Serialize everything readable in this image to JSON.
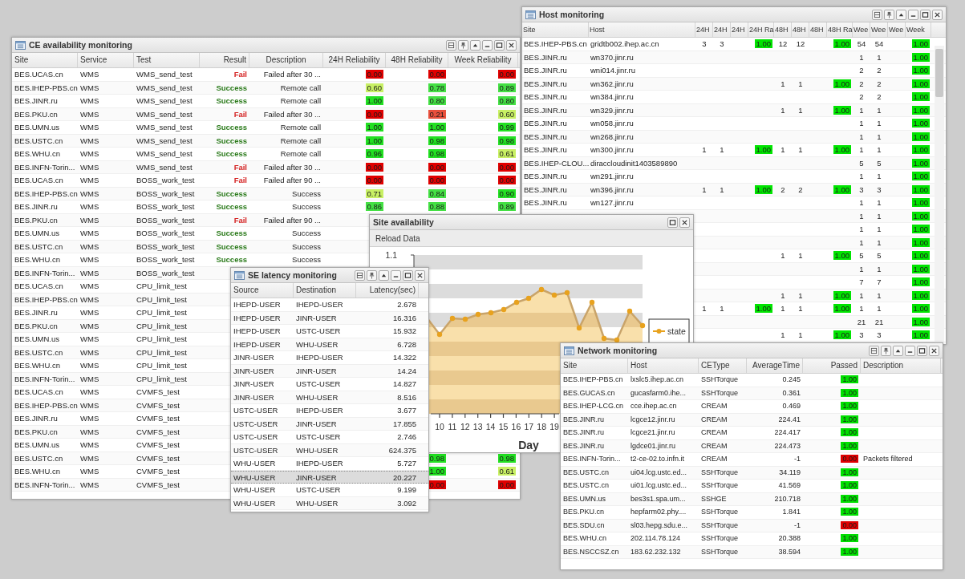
{
  "ce": {
    "title": "CE availability monitoring",
    "columns": [
      "Site",
      "Service",
      "Test",
      "Result",
      "Description",
      "24H Reliability",
      "48H Reliability",
      "Week Reliability"
    ],
    "rows": [
      {
        "site": "BES.UCAS.cn",
        "service": "WMS",
        "test": "WMS_send_test",
        "result": {
          "text": "Fail",
          "color": "#d42020"
        },
        "description": "Failed after 30 ...",
        "r24": {
          "value": "0.00",
          "color": "#e00000"
        },
        "r48": {
          "value": "0.00",
          "color": "#e00000"
        },
        "week": {
          "value": "0.00",
          "color": "#e00000"
        }
      },
      {
        "site": "BES.IHEP-PBS.cn",
        "service": "WMS",
        "test": "WMS_send_test",
        "result": {
          "text": "Success",
          "color": "#2a7a1a"
        },
        "description": "Remote call",
        "r24": {
          "value": "0.60",
          "color": "#c8f064"
        },
        "r48": {
          "value": "0.78",
          "color": "#44e044"
        },
        "week": {
          "value": "0.89",
          "color": "#44e044"
        }
      },
      {
        "site": "BES.JINR.ru",
        "service": "WMS",
        "test": "WMS_send_test",
        "result": {
          "text": "Success",
          "color": "#2a7a1a"
        },
        "description": "Remote call",
        "r24": {
          "value": "1.00",
          "color": "#22e022"
        },
        "r48": {
          "value": "0.80",
          "color": "#44e044"
        },
        "week": {
          "value": "0.80",
          "color": "#44e044"
        }
      },
      {
        "site": "BES.PKU.cn",
        "service": "WMS",
        "test": "WMS_send_test",
        "result": {
          "text": "Fail",
          "color": "#d42020"
        },
        "description": "Failed after 30 ...",
        "r24": {
          "value": "0.00",
          "color": "#e00000"
        },
        "r48": {
          "value": "0.21",
          "color": "#e8503c"
        },
        "week": {
          "value": "0.60",
          "color": "#c8f064"
        }
      },
      {
        "site": "BES.UMN.us",
        "service": "WMS",
        "test": "WMS_send_test",
        "result": {
          "text": "Success",
          "color": "#2a7a1a"
        },
        "description": "Remote call",
        "r24": {
          "value": "1.00",
          "color": "#22e022"
        },
        "r48": {
          "value": "1.00",
          "color": "#22e022"
        },
        "week": {
          "value": "0.99",
          "color": "#22e022"
        }
      },
      {
        "site": "BES.USTC.cn",
        "service": "WMS",
        "test": "WMS_send_test",
        "result": {
          "text": "Success",
          "color": "#2a7a1a"
        },
        "description": "Remote call",
        "r24": {
          "value": "1.00",
          "color": "#22e022"
        },
        "r48": {
          "value": "0.98",
          "color": "#22e022"
        },
        "week": {
          "value": "0.98",
          "color": "#22e022"
        }
      },
      {
        "site": "BES.WHU.cn",
        "service": "WMS",
        "test": "WMS_send_test",
        "result": {
          "text": "Success",
          "color": "#2a7a1a"
        },
        "description": "Remote call",
        "r24": {
          "value": "0.96",
          "color": "#22e022"
        },
        "r48": {
          "value": "0.98",
          "color": "#22e022"
        },
        "week": {
          "value": "0.61",
          "color": "#c8f064"
        }
      },
      {
        "site": "BES.INFN-Torin...",
        "service": "WMS",
        "test": "WMS_send_test",
        "result": {
          "text": "Fail",
          "color": "#d42020"
        },
        "description": "Failed after 30 ...",
        "r24": {
          "value": "0.00",
          "color": "#e00000"
        },
        "r48": {
          "value": "0.00",
          "color": "#e00000"
        },
        "week": {
          "value": "0.00",
          "color": "#e00000"
        }
      },
      {
        "site": "BES.UCAS.cn",
        "service": "WMS",
        "test": "BOSS_work_test",
        "result": {
          "text": "Fail",
          "color": "#d42020"
        },
        "description": "Failed after 90 ...",
        "r24": {
          "value": "0.00",
          "color": "#e00000"
        },
        "r48": {
          "value": "0.00",
          "color": "#e00000"
        },
        "week": {
          "value": "0.00",
          "color": "#e00000"
        }
      },
      {
        "site": "BES.IHEP-PBS.cn",
        "service": "WMS",
        "test": "BOSS_work_test",
        "result": {
          "text": "Success",
          "color": "#2a7a1a"
        },
        "description": "Success",
        "r24": {
          "value": "0.71",
          "color": "#c8f064"
        },
        "r48": {
          "value": "0.84",
          "color": "#44e044"
        },
        "week": {
          "value": "0.90",
          "color": "#22e022"
        }
      },
      {
        "site": "BES.JINR.ru",
        "service": "WMS",
        "test": "BOSS_work_test",
        "result": {
          "text": "Success",
          "color": "#2a7a1a"
        },
        "description": "Success",
        "r24": {
          "value": "0.86",
          "color": "#44e044"
        },
        "r48": {
          "value": "0.88",
          "color": "#44e044"
        },
        "week": {
          "value": "0.89",
          "color": "#44e044"
        }
      },
      {
        "site": "BES.PKU.cn",
        "service": "WMS",
        "test": "BOSS_work_test",
        "result": {
          "text": "Fail",
          "color": "#d42020"
        },
        "description": "Failed after 90 ..."
      },
      {
        "site": "BES.UMN.us",
        "service": "WMS",
        "test": "BOSS_work_test",
        "result": {
          "text": "Success",
          "color": "#2a7a1a"
        },
        "description": "Success"
      },
      {
        "site": "BES.USTC.cn",
        "service": "WMS",
        "test": "BOSS_work_test",
        "result": {
          "text": "Success",
          "color": "#2a7a1a"
        },
        "description": "Success"
      },
      {
        "site": "BES.WHU.cn",
        "service": "WMS",
        "test": "BOSS_work_test",
        "result": {
          "text": "Success",
          "color": "#2a7a1a"
        },
        "description": "Success"
      },
      {
        "site": "BES.INFN-Torin...",
        "service": "WMS",
        "test": "BOSS_work_test"
      },
      {
        "site": "BES.UCAS.cn",
        "service": "WMS",
        "test": "CPU_limit_test"
      },
      {
        "site": "BES.IHEP-PBS.cn",
        "service": "WMS",
        "test": "CPU_limit_test"
      },
      {
        "site": "BES.JINR.ru",
        "service": "WMS",
        "test": "CPU_limit_test"
      },
      {
        "site": "BES.PKU.cn",
        "service": "WMS",
        "test": "CPU_limit_test"
      },
      {
        "site": "BES.UMN.us",
        "service": "WMS",
        "test": "CPU_limit_test"
      },
      {
        "site": "BES.USTC.cn",
        "service": "WMS",
        "test": "CPU_limit_test"
      },
      {
        "site": "BES.WHU.cn",
        "service": "WMS",
        "test": "CPU_limit_test"
      },
      {
        "site": "BES.INFN-Torin...",
        "service": "WMS",
        "test": "CPU_limit_test"
      },
      {
        "site": "BES.UCAS.cn",
        "service": "WMS",
        "test": "CVMFS_test"
      },
      {
        "site": "BES.IHEP-PBS.cn",
        "service": "WMS",
        "test": "CVMFS_test"
      },
      {
        "site": "BES.JINR.ru",
        "service": "WMS",
        "test": "CVMFS_test"
      },
      {
        "site": "BES.PKU.cn",
        "service": "WMS",
        "test": "CVMFS_test"
      },
      {
        "site": "BES.UMN.us",
        "service": "WMS",
        "test": "CVMFS_test"
      },
      {
        "site": "BES.USTC.cn",
        "service": "WMS",
        "test": "CVMFS_test",
        "r48": {
          "value": "0.98",
          "color": "#22e022"
        },
        "week": {
          "value": "0.98",
          "color": "#22e022"
        }
      },
      {
        "site": "BES.WHU.cn",
        "service": "WMS",
        "test": "CVMFS_test",
        "r48": {
          "value": "1.00",
          "color": "#22e022"
        },
        "week": {
          "value": "0.61",
          "color": "#c8f064"
        }
      },
      {
        "site": "BES.INFN-Torin...",
        "service": "WMS",
        "test": "CVMFS_test",
        "r48": {
          "value": "0.00",
          "color": "#e00000"
        },
        "week": {
          "value": "0.00",
          "color": "#e00000"
        }
      }
    ]
  },
  "host": {
    "title": "Host monitoring",
    "columns": [
      "Site",
      "Host",
      "24H",
      "24H",
      "24H",
      "24H Ra",
      "48H",
      "48H",
      "48H",
      "48H Ra",
      "Wee",
      "Wee",
      "Wee",
      "Week"
    ],
    "rows": [
      {
        "site": "BES.IHEP-PBS.cn",
        "host": "gridtb002.ihep.ac.cn",
        "a24": "3",
        "b24": "3",
        "r24": "1.00",
        "a48": "12",
        "b48": "12",
        "r48": "1.00",
        "aw": "54",
        "bw": "54",
        "rw": "1.00"
      },
      {
        "site": "BES.JINR.ru",
        "host": "wn370.jinr.ru",
        "aw": "1",
        "bw": "1",
        "rw": "1.00"
      },
      {
        "site": "BES.JINR.ru",
        "host": "wni014.jinr.ru",
        "aw": "2",
        "bw": "2",
        "rw": "1.00"
      },
      {
        "site": "BES.JINR.ru",
        "host": "wn362.jinr.ru",
        "a48": "1",
        "b48": "1",
        "r48": "1.00",
        "aw": "2",
        "bw": "2",
        "rw": "1.00"
      },
      {
        "site": "BES.JINR.ru",
        "host": "wn384.jinr.ru",
        "aw": "2",
        "bw": "2",
        "rw": "1.00"
      },
      {
        "site": "BES.JINR.ru",
        "host": "wn329.jinr.ru",
        "a48": "1",
        "b48": "1",
        "r48": "1.00",
        "aw": "1",
        "bw": "1",
        "rw": "1.00"
      },
      {
        "site": "BES.JINR.ru",
        "host": "wn058.jinr.ru",
        "aw": "1",
        "bw": "1",
        "rw": "1.00"
      },
      {
        "site": "BES.JINR.ru",
        "host": "wn268.jinr.ru",
        "aw": "1",
        "bw": "1",
        "rw": "1.00"
      },
      {
        "site": "BES.JINR.ru",
        "host": "wn300.jinr.ru",
        "a24": "1",
        "b24": "1",
        "r24": "1.00",
        "a48": "1",
        "b48": "1",
        "r48": "1.00",
        "aw": "1",
        "bw": "1",
        "rw": "1.00"
      },
      {
        "site": "BES.IHEP-CLOU...",
        "host": "diraccloudinit1403589890",
        "aw": "5",
        "bw": "5",
        "rw": "1.00"
      },
      {
        "site": "BES.JINR.ru",
        "host": "wn291.jinr.ru",
        "aw": "1",
        "bw": "1",
        "rw": "1.00"
      },
      {
        "site": "BES.JINR.ru",
        "host": "wn396.jinr.ru",
        "a24": "1",
        "b24": "1",
        "r24": "1.00",
        "a48": "2",
        "b48": "2",
        "r48": "1.00",
        "aw": "3",
        "bw": "3",
        "rw": "1.00"
      },
      {
        "site": "BES.JINR.ru",
        "host": "wn127.jinr.ru",
        "aw": "1",
        "bw": "1",
        "rw": "1.00"
      },
      {
        "aw": "1",
        "bw": "1",
        "rw": "1.00"
      },
      {
        "aw": "1",
        "bw": "1",
        "rw": "1.00"
      },
      {
        "aw": "1",
        "bw": "1",
        "rw": "1.00"
      },
      {
        "a48": "1",
        "b48": "1",
        "r48": "1.00",
        "aw": "5",
        "bw": "5",
        "rw": "1.00"
      },
      {
        "aw": "1",
        "bw": "1",
        "rw": "1.00"
      },
      {
        "aw": "7",
        "bw": "7",
        "rw": "1.00"
      },
      {
        "a48": "1",
        "b48": "1",
        "r48": "1.00",
        "aw": "1",
        "bw": "1",
        "rw": "1.00"
      },
      {
        "a24": "1",
        "b24": "1",
        "r24": "1.00",
        "a48": "1",
        "b48": "1",
        "r48": "1.00",
        "aw": "1",
        "bw": "1",
        "rw": "1.00"
      },
      {
        "aw": "21",
        "bw": "21",
        "rw": "1.00"
      },
      {
        "a48": "1",
        "b48": "1",
        "r48": "1.00",
        "aw": "3",
        "bw": "3",
        "rw": "1.00"
      }
    ]
  },
  "site_availability": {
    "title": "Site availability",
    "toolbar_button": "Reload Data",
    "y_tick": "1.1",
    "x_ticks": [
      "10",
      "11",
      "12",
      "13",
      "14",
      "15",
      "16",
      "17",
      "18",
      "19"
    ],
    "x_title": "Day",
    "legend": "state"
  },
  "se_latency": {
    "title": "SE latency monitoring",
    "columns": [
      "Source",
      "Destination",
      "Latency(sec)"
    ],
    "rows": [
      {
        "source": "IHEPD-USER",
        "destination": "IHEPD-USER",
        "latency": "2.678",
        "selected": false
      },
      {
        "source": "IHEPD-USER",
        "destination": "JINR-USER",
        "latency": "16.316",
        "selected": false
      },
      {
        "source": "IHEPD-USER",
        "destination": "USTC-USER",
        "latency": "15.932",
        "selected": false
      },
      {
        "source": "IHEPD-USER",
        "destination": "WHU-USER",
        "latency": "6.728",
        "selected": false
      },
      {
        "source": "JINR-USER",
        "destination": "IHEPD-USER",
        "latency": "14.322",
        "selected": false
      },
      {
        "source": "JINR-USER",
        "destination": "JINR-USER",
        "latency": "14.24",
        "selected": false
      },
      {
        "source": "JINR-USER",
        "destination": "USTC-USER",
        "latency": "14.827",
        "selected": false
      },
      {
        "source": "JINR-USER",
        "destination": "WHU-USER",
        "latency": "8.516",
        "selected": false
      },
      {
        "source": "USTC-USER",
        "destination": "IHEPD-USER",
        "latency": "3.677",
        "selected": false
      },
      {
        "source": "USTC-USER",
        "destination": "JINR-USER",
        "latency": "17.855",
        "selected": false
      },
      {
        "source": "USTC-USER",
        "destination": "USTC-USER",
        "latency": "2.746",
        "selected": false
      },
      {
        "source": "USTC-USER",
        "destination": "WHU-USER",
        "latency": "624.375",
        "selected": false
      },
      {
        "source": "WHU-USER",
        "destination": "IHEPD-USER",
        "latency": "5.727",
        "selected": false
      },
      {
        "source": "WHU-USER",
        "destination": "JINR-USER",
        "latency": "20.227",
        "selected": true
      },
      {
        "source": "WHU-USER",
        "destination": "USTC-USER",
        "latency": "9.199",
        "selected": false
      },
      {
        "source": "WHU-USER",
        "destination": "WHU-USER",
        "latency": "3.092",
        "selected": false
      }
    ]
  },
  "network": {
    "title": "Network monitoring",
    "columns": [
      "Site",
      "Host",
      "CEType",
      "AverageTime",
      "Passed",
      "Description"
    ],
    "rows": [
      {
        "site": "BES.IHEP-PBS.cn",
        "host": "lxslc5.ihep.ac.cn",
        "cetype": "SSHTorque",
        "average_time": "0.245",
        "passed": {
          "value": "1.00",
          "color": "#00e000"
        }
      },
      {
        "site": "BES.GUCAS.cn",
        "host": "gucasfarm0.ihe...",
        "cetype": "SSHTorque",
        "average_time": "0.361",
        "passed": {
          "value": "1.00",
          "color": "#00e000"
        }
      },
      {
        "site": "BES.IHEP-LCG.cn",
        "host": "cce.ihep.ac.cn",
        "cetype": "CREAM",
        "average_time": "0.469",
        "passed": {
          "value": "1.00",
          "color": "#00e000"
        }
      },
      {
        "site": "BES.JINR.ru",
        "host": "lcgce12.jinr.ru",
        "cetype": "CREAM",
        "average_time": "224.41",
        "passed": {
          "value": "1.00",
          "color": "#00e000"
        }
      },
      {
        "site": "BES.JINR.ru",
        "host": "lcgce21.jinr.ru",
        "cetype": "CREAM",
        "average_time": "224.417",
        "passed": {
          "value": "1.00",
          "color": "#00e000"
        }
      },
      {
        "site": "BES.JINR.ru",
        "host": "lgdce01.jinr.ru",
        "cetype": "CREAM",
        "average_time": "224.473",
        "passed": {
          "value": "1.00",
          "color": "#00e000"
        }
      },
      {
        "site": "BES.INFN-Torin...",
        "host": "t2-ce-02.to.infn.it",
        "cetype": "CREAM",
        "average_time": "-1",
        "passed": {
          "value": "0.00",
          "color": "#e00000"
        },
        "description": "Packets filtered"
      },
      {
        "site": "BES.USTC.cn",
        "host": "ui04.lcg.ustc.ed...",
        "cetype": "SSHTorque",
        "average_time": "34.119",
        "passed": {
          "value": "1.00",
          "color": "#00e000"
        }
      },
      {
        "site": "BES.USTC.cn",
        "host": "ui01.lcg.ustc.ed...",
        "cetype": "SSHTorque",
        "average_time": "41.569",
        "passed": {
          "value": "1.00",
          "color": "#00e000"
        }
      },
      {
        "site": "BES.UMN.us",
        "host": "bes3s1.spa.um...",
        "cetype": "SSHGE",
        "average_time": "210.718",
        "passed": {
          "value": "1.00",
          "color": "#00e000"
        }
      },
      {
        "site": "BES.PKU.cn",
        "host": "hepfarm02.phy....",
        "cetype": "SSHTorque",
        "average_time": "1.841",
        "passed": {
          "value": "1.00",
          "color": "#00e000"
        }
      },
      {
        "site": "BES.SDU.cn",
        "host": "sl03.hepg.sdu.e...",
        "cetype": "SSHTorque",
        "average_time": "-1",
        "passed": {
          "value": "0.00",
          "color": "#e00000"
        }
      },
      {
        "site": "BES.WHU.cn",
        "host": "202.114.78.124",
        "cetype": "SSHTorque",
        "average_time": "20.388",
        "passed": {
          "value": "1.00",
          "color": "#00e000"
        }
      },
      {
        "site": "BES.NSCCSZ.cn",
        "host": "183.62.232.132",
        "cetype": "SSHTorque",
        "average_time": "38.594",
        "passed": {
          "value": "1.00",
          "color": "#00e000"
        }
      }
    ]
  }
}
